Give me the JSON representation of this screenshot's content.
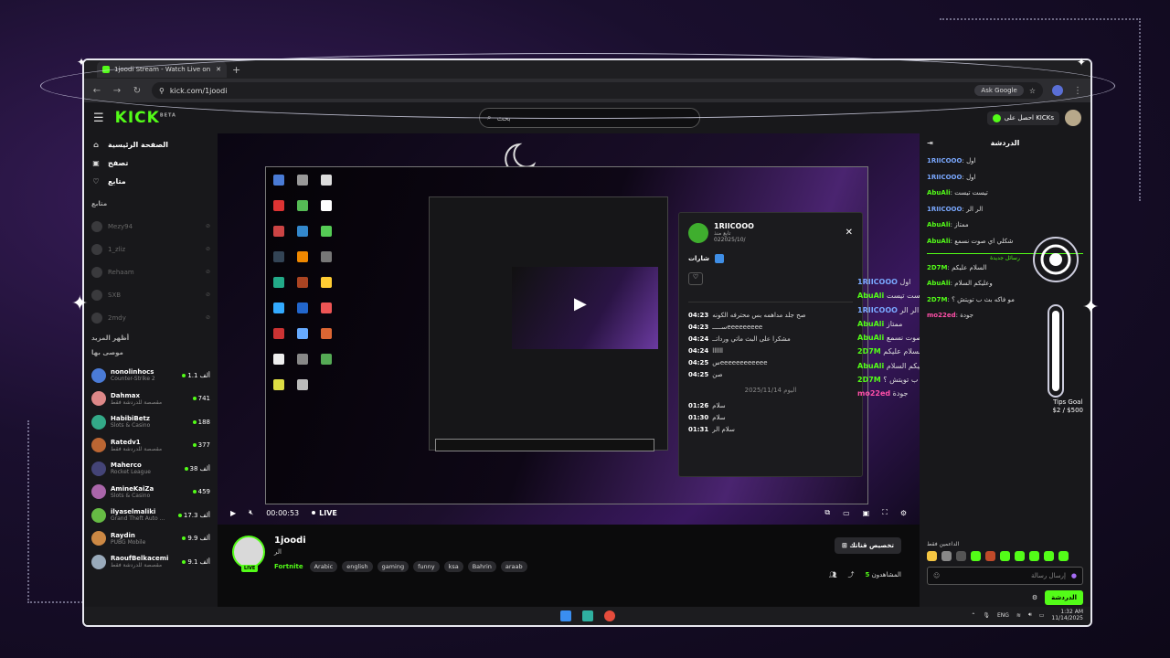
{
  "browser": {
    "tab_title": "1joodi Stream - Watch Live on Kick",
    "url": "kick.com/1joodi",
    "ask_google": "Ask Google"
  },
  "header": {
    "logo": "KICK",
    "logo_beta": "BETA",
    "search_placeholder": "بحث",
    "get_kicks": "احصل على KICKs"
  },
  "sidebar": {
    "nav": [
      {
        "label": "الصفحة الرئيسية",
        "icon": "home-icon"
      },
      {
        "label": "تصفح",
        "icon": "browse-icon"
      },
      {
        "label": "متابع",
        "icon": "heart-icon"
      }
    ],
    "following_title": "متابع",
    "following": [
      "Mezy94",
      "1_zliz",
      "Rehaam",
      "SXB",
      "2mdy"
    ],
    "show_more": "أظهر المزيد",
    "recommended_title": "موصى بها",
    "recommended": [
      {
        "name": "nonolinhocs",
        "category": "Counter-Strike 2",
        "viewers": "1.1 ألف"
      },
      {
        "name": "Dahmax",
        "category": "مقصصة للدردشة فقط",
        "viewers": "741"
      },
      {
        "name": "HabibiBetz",
        "category": "Slots & Casino",
        "viewers": "188"
      },
      {
        "name": "Ratedv1",
        "category": "مقصصة للدردشة فقط",
        "viewers": "377"
      },
      {
        "name": "Maherco",
        "category": "Rocket League",
        "viewers": "38 ألف"
      },
      {
        "name": "AmineKaiZa",
        "category": "Slots & Casino",
        "viewers": "459"
      },
      {
        "name": "ilyaselmaliki",
        "category": "Grand Theft Auto ...",
        "viewers": "17.3 ألف"
      },
      {
        "name": "Raydin",
        "category": "PUBG Mobile",
        "viewers": "9.9 ألف"
      },
      {
        "name": "RaoufBelkacemi",
        "category": "مقصصة للدردشة فقط",
        "viewers": "9.1 ألف"
      }
    ]
  },
  "player": {
    "time": "00:00:53",
    "live": "LIVE"
  },
  "popup": {
    "username": "1RIICOOO",
    "followed_label": "تابع منذ",
    "followed_date": "022025/10/",
    "badges_label": "شارات",
    "messages": [
      {
        "time": "04:23",
        "text": "صح جلد مداهمه بس محترفه الكونه"
      },
      {
        "time": "04:23",
        "text": "ســـــeeeeeeeee"
      },
      {
        "time": "04:24",
        "text": "مشكرا على البث ماتي ورداتــ"
      },
      {
        "time": "04:24",
        "text": "llllll"
      },
      {
        "time": "04:25",
        "text": "سeeeeeeeeeeee"
      },
      {
        "time": "04:25",
        "text": "صن"
      }
    ],
    "date_sep": "اليوم 2025/11/14",
    "messages2": [
      {
        "time": "01:26",
        "text": "سلام"
      },
      {
        "time": "01:30",
        "text": "سلام"
      },
      {
        "time": "01:31",
        "text": "سلام الر"
      }
    ]
  },
  "overlay_chat": [
    {
      "user": "1RIICOOO",
      "text": "اول",
      "color": "#7aa8ff"
    },
    {
      "user": "AbuAli",
      "text": "تيست تيست",
      "color": "#53fc18"
    },
    {
      "user": "1RIICOOO",
      "text": "الر الر",
      "color": "#7aa8ff"
    },
    {
      "user": "AbuAli",
      "text": "ممتاز",
      "color": "#53fc18"
    },
    {
      "user": "AbuAli",
      "text": "شكلي اي صوت نسمع",
      "color": "#53fc18"
    },
    {
      "user": "2D7M",
      "text": "السلام عليكم",
      "color": "#53fc18"
    },
    {
      "user": "AbuAli",
      "text": "وعليكم السلام",
      "color": "#53fc18"
    },
    {
      "user": "2D7M",
      "text": "مو فاكه بث ب تويتش ؟",
      "color": "#53fc18"
    },
    {
      "user": "mo22ed",
      "text": "جودة",
      "color": "#ff4fa8"
    }
  ],
  "stream": {
    "title": "1joodi",
    "subtitle": "الر",
    "live_badge": "LIVE",
    "game": "Fortnite",
    "tags": [
      "Arabic",
      "english",
      "gaming",
      "funny",
      "ksa",
      "Bahrin",
      "araab"
    ],
    "customize": "تخصيص قناتك",
    "viewers_label": "المشاهدون",
    "viewers": "5"
  },
  "chat": {
    "title": "الدردشة",
    "messages": [
      {
        "user": "1RIICOOO",
        "text": "اول",
        "color": "#7aa8ff"
      },
      {
        "user": "1RIICOOO",
        "text": "اول",
        "color": "#7aa8ff"
      },
      {
        "user": "AbuAli",
        "text": "تيست تيست",
        "color": "#53fc18"
      },
      {
        "user": "1RIICOOO",
        "text": "الر الر",
        "color": "#7aa8ff"
      },
      {
        "user": "AbuAli",
        "text": "ممتاز",
        "color": "#53fc18"
      },
      {
        "user": "AbuAli",
        "text": "شكلي اي صوت نسمع",
        "color": "#53fc18"
      },
      {
        "user": "",
        "text": "رسائل جديدة",
        "color": "#53fc18"
      },
      {
        "user": "2D7M",
        "text": "السلام عليكم",
        "color": "#53fc18"
      },
      {
        "user": "AbuAli",
        "text": "وعليكم السلام",
        "color": "#53fc18"
      },
      {
        "user": "2D7M",
        "text": "مو فاكه بث ب تويتش ؟",
        "color": "#53fc18"
      },
      {
        "user": "mo22ed",
        "text": "جودة",
        "color": "#ff4fa8"
      }
    ],
    "tips_goal_label": "Tips Goal",
    "tips_goal_value": "$2 / $500",
    "supporters": "الداعمين فقط",
    "input_placeholder": "إرسال رسالة",
    "send": "الدردشة"
  },
  "taskbar": {
    "lang": "ENG",
    "time": "1:32 AM",
    "date": "11/14/2025"
  },
  "colors": {
    "accent": "#53fc18",
    "background": "#0b0b0c",
    "panel": "#18181b"
  }
}
